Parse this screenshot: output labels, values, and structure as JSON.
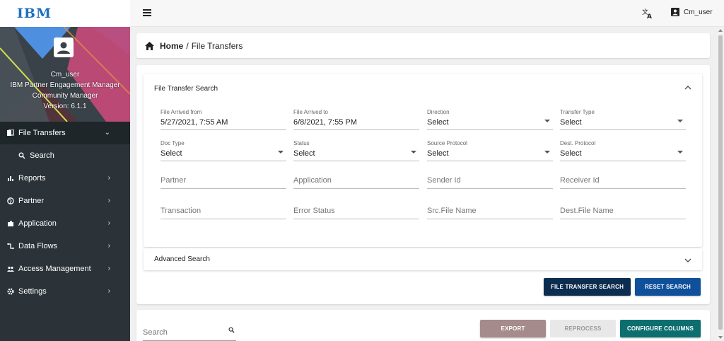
{
  "brand": {
    "logo_text": "IBM"
  },
  "profile": {
    "username": "Cm_user",
    "product_line1": "IBM Partner Engagement Manager",
    "role": "Community Manager",
    "version": "Version: 6.1.1"
  },
  "sidebar": {
    "items": [
      {
        "label": "File Transfers",
        "icon": "file-copy-icon",
        "expanded": true
      },
      {
        "label": "Search",
        "icon": "search-icon",
        "sub": true
      },
      {
        "label": "Reports",
        "icon": "bar-chart-icon"
      },
      {
        "label": "Partner",
        "icon": "globe-icon"
      },
      {
        "label": "Application",
        "icon": "puzzle-icon"
      },
      {
        "label": "Data Flows",
        "icon": "data-flow-icon"
      },
      {
        "label": "Access Management",
        "icon": "people-icon"
      },
      {
        "label": "Settings",
        "icon": "gear-icon"
      }
    ]
  },
  "topbar": {
    "user": "Cm_user"
  },
  "breadcrumb": {
    "home": "Home",
    "separator": "/",
    "current": "File Transfers"
  },
  "search_panel": {
    "title": "File Transfer Search",
    "fields": {
      "arrived_from": {
        "label": "File Arrived from",
        "value": "5/27/2021, 7:55 AM"
      },
      "arrived_to": {
        "label": "File Arrived to",
        "value": "6/8/2021, 7:55 PM"
      },
      "direction": {
        "label": "Direction",
        "value": "Select"
      },
      "transfer_type": {
        "label": "Transfer Type",
        "value": "Select"
      },
      "doc_type": {
        "label": "Doc Type",
        "value": "Select"
      },
      "status": {
        "label": "Status",
        "value": "Select"
      },
      "source_protocol": {
        "label": "Source Protocol",
        "value": "Select"
      },
      "dest_protocol": {
        "label": "Dest. Protocol",
        "value": "Select"
      },
      "partner": {
        "placeholder": "Partner"
      },
      "application": {
        "placeholder": "Application"
      },
      "sender_id": {
        "placeholder": "Sender Id"
      },
      "receiver_id": {
        "placeholder": "Receiver Id"
      },
      "transaction": {
        "placeholder": "Transaction"
      },
      "error_status": {
        "placeholder": "Error Status"
      },
      "src_file_name": {
        "placeholder": "Src.File Name"
      },
      "dest_file_name": {
        "placeholder": "Dest.File Name"
      }
    }
  },
  "advanced": {
    "title": "Advanced Search"
  },
  "buttons": {
    "file_transfer_search": "FILE TRANSFER SEARCH",
    "reset_search": "RESET SEARCH",
    "export": "EXPORT",
    "reprocess": "REPROCESS",
    "configure_columns": "CONFIGURE COLUMNS"
  },
  "results": {
    "search_placeholder": "Search"
  },
  "colors": {
    "sidebar_bg": "#2b3338",
    "primary_dark": "#0c2d4f",
    "primary": "#10509a",
    "export": "#a58b8b",
    "teal": "#0c6e6e"
  }
}
